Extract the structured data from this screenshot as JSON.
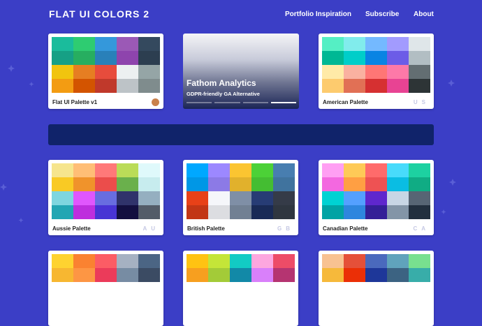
{
  "header": {
    "logo": "FLAT UI COLORS 2",
    "nav": [
      "Portfolio Inspiration",
      "Subscribe",
      "About"
    ]
  },
  "ad": {
    "title": "Fathom Analytics",
    "subtitle": "GDPR-friendly GA Alternative",
    "slides": 4,
    "active_slide": 4
  },
  "palettes": [
    {
      "name": "Flat UI Palette v1",
      "flag": "",
      "avatar": "avatar-icon",
      "colors": [
        "#1abc9c",
        "#2ecc71",
        "#3498db",
        "#9b59b6",
        "#34495e",
        "#16a085",
        "#27ae60",
        "#2980b9",
        "#8e44ad",
        "#2c3e50",
        "#f1c40f",
        "#e67e22",
        "#e74c3c",
        "#ecf0f1",
        "#95a5a6",
        "#f39c12",
        "#d35400",
        "#c0392b",
        "#bdc3c7",
        "#7f8c8d"
      ]
    },
    {
      "name": "American Palette",
      "flag": "US",
      "avatar": "",
      "colors": [
        "#55efc4",
        "#81ecec",
        "#74b9ff",
        "#a29bfe",
        "#dfe6e9",
        "#00b894",
        "#00cec9",
        "#0984e3",
        "#6c5ce7",
        "#b2bec3",
        "#ffeaa7",
        "#fab1a0",
        "#ff7675",
        "#fd79a8",
        "#636e72",
        "#fdcb6e",
        "#e17055",
        "#d63031",
        "#e84393",
        "#2d3436"
      ]
    },
    {
      "name": "Aussie Palette",
      "flag": "AU",
      "avatar": "",
      "colors": [
        "#f6e58d",
        "#ffbe76",
        "#ff7979",
        "#badc58",
        "#dff9fb",
        "#f9ca24",
        "#f0932b",
        "#eb4d4b",
        "#6ab04c",
        "#c7ecee",
        "#7ed6df",
        "#e056fd",
        "#686de0",
        "#30336b",
        "#95afc0",
        "#22a6b3",
        "#be2edd",
        "#4834d4",
        "#130f40",
        "#535c68"
      ]
    },
    {
      "name": "British Palette",
      "flag": "GB",
      "avatar": "",
      "colors": [
        "#00a8ff",
        "#9c88ff",
        "#fbc531",
        "#4cd137",
        "#487eb0",
        "#0097e6",
        "#8c7ae6",
        "#e1b12c",
        "#44bd32",
        "#40739e",
        "#e84118",
        "#f5f6fa",
        "#7f8fa6",
        "#273c75",
        "#353b48",
        "#c23616",
        "#dcdde1",
        "#718093",
        "#192a56",
        "#2f3640"
      ]
    },
    {
      "name": "Canadian Palette",
      "flag": "CA",
      "avatar": "",
      "colors": [
        "#ff9ff3",
        "#feca57",
        "#ff6b6b",
        "#48dbfb",
        "#1dd1a1",
        "#f368e0",
        "#ff9f43",
        "#ee5253",
        "#0abde3",
        "#10ac84",
        "#00d2d3",
        "#54a0ff",
        "#5f27cd",
        "#c8d6e5",
        "#576574",
        "#01a3a4",
        "#2e86de",
        "#341f97",
        "#8395a7",
        "#222f3e"
      ]
    },
    {
      "name": "",
      "flag": "",
      "avatar": "",
      "colors": [
        "#fed330",
        "#fa8231",
        "#fc5c65",
        "#a5b1c2",
        "#4b6584",
        "#f7b731",
        "#fd9644",
        "#eb3b5a",
        "#778ca3",
        "#3b4b63"
      ]
    },
    {
      "name": "",
      "flag": "",
      "avatar": "",
      "colors": [
        "#ffc312",
        "#c4e538",
        "#12cbc4",
        "#fda7df",
        "#ed4c67",
        "#f79f1f",
        "#a3cb38",
        "#1289a7",
        "#d980fa",
        "#b53471"
      ]
    },
    {
      "name": "",
      "flag": "",
      "avatar": "",
      "colors": [
        "#f8c291",
        "#e55039",
        "#4a69bd",
        "#60a3bc",
        "#78e08f",
        "#f6b93b",
        "#eb2f06",
        "#1e3799",
        "#3c6382",
        "#38ada9"
      ]
    }
  ]
}
